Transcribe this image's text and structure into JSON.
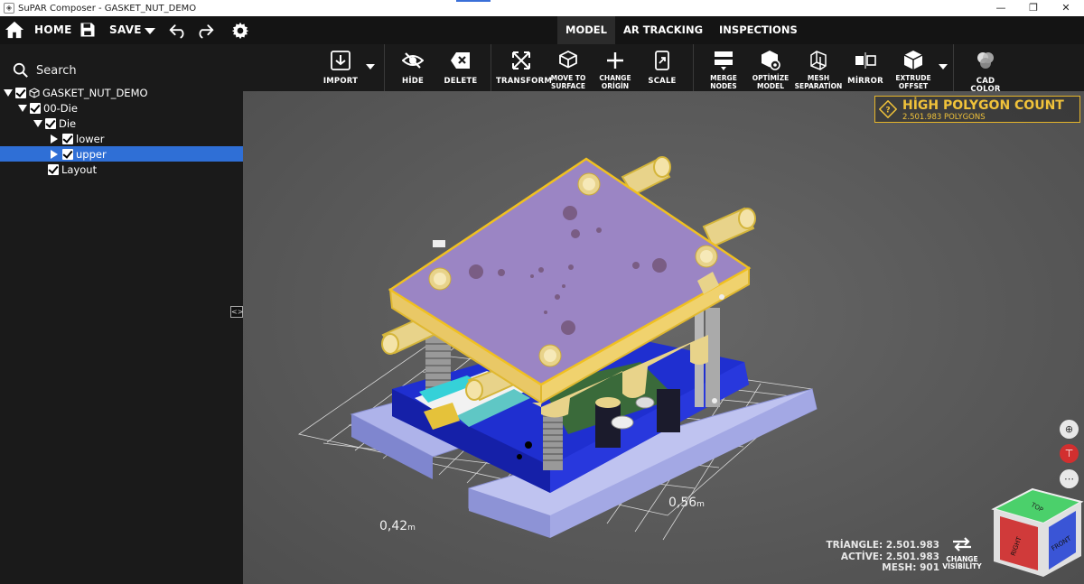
{
  "window": {
    "title": "SuPAR Composer - GASKET_NUT_DEMO",
    "minimize": "—",
    "restore": "❐",
    "close": "✕"
  },
  "menubar": {
    "home_label": "HOME",
    "save_label": "SAVE",
    "tabs": [
      {
        "label": "MODEL",
        "active": true
      },
      {
        "label": "AR TRACKING",
        "active": false
      },
      {
        "label": "INSPECTIONS",
        "active": false
      }
    ]
  },
  "sidebar": {
    "search_placeholder": "Search",
    "tree": [
      {
        "label": "GASKET_NUT_DEMO",
        "level": 0,
        "expanded": true,
        "checked": true
      },
      {
        "label": "00-Die",
        "level": 1,
        "expanded": true,
        "checked": true
      },
      {
        "label": "Die",
        "level": 2,
        "expanded": true,
        "checked": true
      },
      {
        "label": "lower",
        "level": 3,
        "expanded": false,
        "checked": true
      },
      {
        "label": "upper",
        "level": 3,
        "expanded": false,
        "checked": true,
        "selected": true
      },
      {
        "label": "Layout",
        "level": 3,
        "checked": true
      }
    ]
  },
  "toolbar": {
    "import": "IMPORT",
    "hide": "HİDE",
    "delete": "DELETE",
    "transform": "TRANSFORM",
    "move_to_surface": [
      "MOVE TO",
      "SURFACE"
    ],
    "change_origin": [
      "CHANGE",
      "ORİGİN"
    ],
    "scale": "SCALE",
    "merge_nodes": [
      "MERGE",
      "NODES"
    ],
    "optimize_model": [
      "OPTİMİZE",
      "MODEL"
    ],
    "mesh_separation": [
      "MESH",
      "SEPARATİON"
    ],
    "mirror": "MİRROR",
    "extrude_offset": [
      "EXTRUDE",
      "OFFSET"
    ],
    "cad_color": "CAD COLOR"
  },
  "viewport": {
    "warning_title": "HİGH POLYGON COUNT",
    "warning_sub": "2.501.983 POLYGONS",
    "dim_width": "0,56",
    "dim_depth": "0,42",
    "dim_unit": "m",
    "stats": {
      "triangle": "TRİANGLE: 2.501.983",
      "active": "ACTİVE: 2.501.983",
      "mesh": "MESH: 901"
    },
    "change_visibility": [
      "CHANGE",
      "VİSİBİLİTY"
    ],
    "cube_labels": {
      "top": "TOP",
      "right": "RIGHT",
      "front": "FRONT"
    }
  },
  "colors": {
    "accent": "#2f6fd6",
    "warning": "#e6b52a",
    "plate_purple": "#9b85c4",
    "base_blue": "#1f2fd0",
    "brass": "#e8d38a"
  }
}
